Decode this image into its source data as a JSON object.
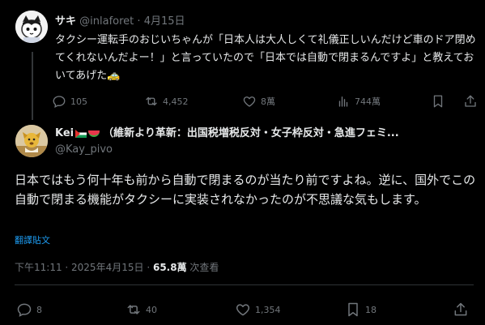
{
  "parent_tweet": {
    "name": "サキ",
    "handle": "@inlaforet",
    "separator": "·",
    "date": "4月15日",
    "text": "タクシー運転手のおじいちゃんが「日本人は大人しくて礼儀正しいんだけど車のドア閉めてくれないんだよー！」と言っていたので「日本では自動で閉まるんですよ」と教えておいてあげた🚕",
    "replies": "105",
    "reposts": "4,452",
    "likes": "8萬",
    "views": "744萬"
  },
  "reply_tweet": {
    "name_prefix": "Kei",
    "name_suffix": "（維新より革新：出国税増税反対・女子枠反対・急進フェミ...",
    "handle": "@Kay_pivo",
    "text": "日本ではもう何十年も前から自動で閉まるのが当たり前ですよね。逆に、国外でこの自動で閉まる機能がタクシーに実装されなかったのが不思議な気もします。",
    "translate_label": "翻譯貼文",
    "timestamp": "下午11:11 · 2025年4月15日",
    "separator": "·",
    "views_count": "65.8萬",
    "views_label": "次查看",
    "replies": "8",
    "reposts": "40",
    "likes": "1,354",
    "bookmarks": "18"
  },
  "colors": {
    "background": "#000000",
    "text": "#e7e9ea",
    "muted": "#71767b",
    "link": "#1d9bf0",
    "divider": "#2f3336"
  }
}
